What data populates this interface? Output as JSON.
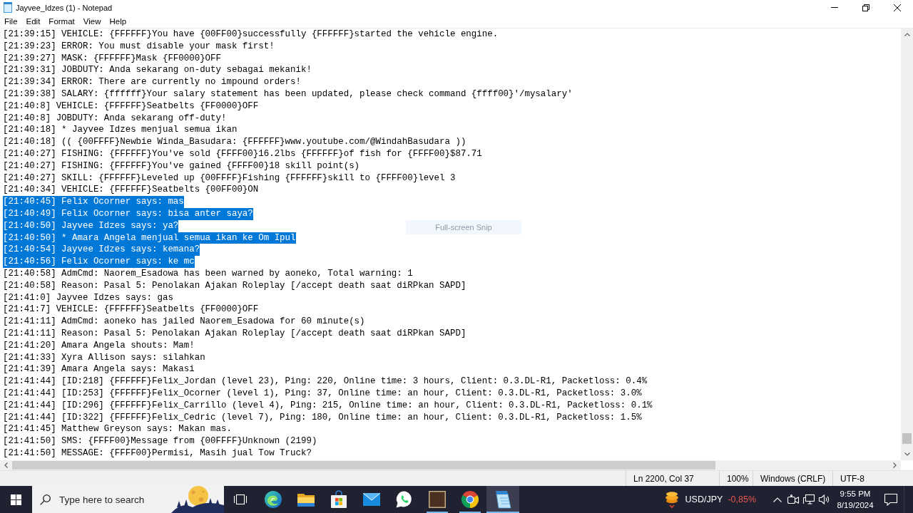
{
  "window": {
    "title": "Jayvee_Idzes (1) - Notepad"
  },
  "menu": [
    "File",
    "Edit",
    "Format",
    "View",
    "Help"
  ],
  "lines": [
    {
      "text": "[21:39:15] VEHICLE: {FFFFFF}You have {00FF00}successfully {FFFFFF}started the vehicle engine.",
      "selected": false
    },
    {
      "text": "[21:39:23] ERROR: You must disable your mask first!",
      "selected": false
    },
    {
      "text": "[21:39:27] MASK: {FFFFFF}Mask {FF0000}OFF",
      "selected": false
    },
    {
      "text": "[21:39:31] JOBDUTY: Anda sekarang on-duty sebagai mekanik!",
      "selected": false
    },
    {
      "text": "[21:39:34] ERROR: There are currently no impound orders!",
      "selected": false
    },
    {
      "text": "[21:39:38] SALARY: {ffffff}Your salary statement has been updated, please check command {ffff00}'/mysalary'",
      "selected": false
    },
    {
      "text": "[21:40:8] VEHICLE: {FFFFFF}Seatbelts {FF0000}OFF",
      "selected": false
    },
    {
      "text": "[21:40:8] JOBDUTY: Anda sekarang off-duty!",
      "selected": false
    },
    {
      "text": "[21:40:18] * Jayvee Idzes menjual semua ikan",
      "selected": false
    },
    {
      "text": "[21:40:18] (( {00FFFF}Newbie Winda_Basudara: {FFFFFF}www.youtube.com/@WindahBasudara ))",
      "selected": false
    },
    {
      "text": "[21:40:27] FISHING: {FFFFFF}You've sold {FFFF00}16.2lbs {FFFFFF}of fish for {FFFF00}$87.71",
      "selected": false
    },
    {
      "text": "[21:40:27] FISHING: {FFFFFF}You've gained {FFFF00}18 skill point(s)",
      "selected": false
    },
    {
      "text": "[21:40:27] SKILL: {FFFFFF}Leveled up {00FFFF}Fishing {FFFFFF}skill to {FFFF00}level 3",
      "selected": false
    },
    {
      "text": "[21:40:34] VEHICLE: {FFFFFF}Seatbelts {00FF00}ON",
      "selected": false
    },
    {
      "text": "[21:40:45] Felix Ocorner says: mas",
      "selected": true
    },
    {
      "text": "[21:40:49] Felix Ocorner says: bisa anter saya?",
      "selected": true
    },
    {
      "text": "[21:40:50] Jayvee Idzes says: ya?",
      "selected": true
    },
    {
      "text": "[21:40:50] * Amara Angela menjual semua ikan ke Om Ipul",
      "selected": true
    },
    {
      "text": "[21:40:54] Jayvee Idzes says: kemana?",
      "selected": true
    },
    {
      "text": "[21:40:56] Felix Ocorner says: ke mc",
      "selected": true
    },
    {
      "text": "[21:40:58] AdmCmd: Naorem_Esadowa has been warned by aoneko, Total warning: 1",
      "selected": false
    },
    {
      "text": "[21:40:58] Reason: Pasal 5: Penolakan Ajakan Roleplay [/accept death saat diRPkan SAPD]",
      "selected": false
    },
    {
      "text": "[21:41:0] Jayvee Idzes says: gas",
      "selected": false
    },
    {
      "text": "[21:41:7] VEHICLE: {FFFFFF}Seatbelts {FF0000}OFF",
      "selected": false
    },
    {
      "text": "[21:41:11] AdmCmd: aoneko has jailed Naorem_Esadowa for 60 minute(s)",
      "selected": false
    },
    {
      "text": "[21:41:11] Reason: Pasal 5: Penolakan Ajakan Roleplay [/accept death saat diRPkan SAPD]",
      "selected": false
    },
    {
      "text": "[21:41:20] Amara Angela shouts: Mam!",
      "selected": false
    },
    {
      "text": "[21:41:33] Xyra Allison says: silahkan",
      "selected": false
    },
    {
      "text": "[21:41:39] Amara Angela says: Makasi",
      "selected": false
    },
    {
      "text": "[21:41:44] [ID:218] {FFFFFF}Felix_Jordan (level 23), Ping: 220, Online time: 3 hours, Client: 0.3.DL-R1, Packetloss: 0.4%",
      "selected": false
    },
    {
      "text": "[21:41:44] [ID:253] {FFFFFF}Felix_Ocorner (level 1), Ping: 37, Online time: an hour, Client: 0.3.DL-R1, Packetloss: 3.0%",
      "selected": false
    },
    {
      "text": "[21:41:44] [ID:296] {FFFFFF}Felix_Carrillo (level 4), Ping: 215, Online time: an hour, Client: 0.3.DL-R1, Packetloss: 0.1%",
      "selected": false
    },
    {
      "text": "[21:41:44] [ID:322] {FFFFFF}Felix_Cedric (level 7), Ping: 180, Online time: an hour, Client: 0.3.DL-R1, Packetloss: 1.5%",
      "selected": false
    },
    {
      "text": "[21:41:45] Matthew Greyson says: Makan mas.",
      "selected": false
    },
    {
      "text": "[21:41:50] SMS: {FFFF00}Message from {00FFFF}Unknown (2199)",
      "selected": false
    },
    {
      "text": "[21:41:50] MESSAGE: {FFFF00}Permisi, Masih jual Tow Truck?",
      "selected": false
    }
  ],
  "snip_tooltip": "Full-screen Snip",
  "status_bar": {
    "position": "Ln 2200, Col 37",
    "zoom": "100%",
    "line_ending": "Windows (CRLF)",
    "encoding": "UTF-8"
  },
  "taskbar": {
    "search": {
      "placeholder": "Type here to search"
    },
    "apps": [
      {
        "kind": "taskview",
        "running": false,
        "active": false
      },
      {
        "kind": "edge",
        "running": false,
        "active": false
      },
      {
        "kind": "files",
        "running": false,
        "active": false
      },
      {
        "kind": "store",
        "running": false,
        "active": false
      },
      {
        "kind": "mail",
        "running": false,
        "active": false
      },
      {
        "kind": "whatsapp",
        "running": false,
        "active": false
      },
      {
        "kind": "game",
        "running": true,
        "active": false
      },
      {
        "kind": "chrome",
        "running": true,
        "active": false
      },
      {
        "kind": "notepad",
        "running": true,
        "active": true
      }
    ],
    "ticker": {
      "symbol": "USD/JPY",
      "change": "-0,85%"
    },
    "clock": {
      "time": "9:55 PM",
      "date": "8/19/2024"
    }
  }
}
